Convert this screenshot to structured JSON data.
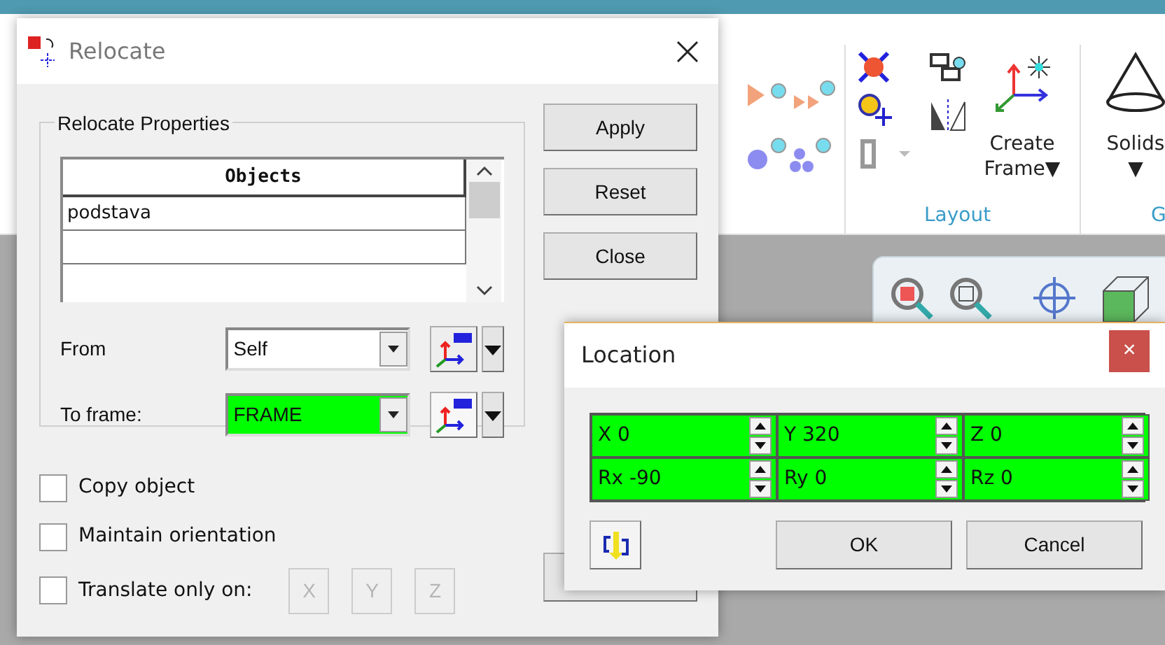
{
  "ribbon": {
    "buttons": [
      {
        "label": "Create Frame",
        "caret": "▼"
      },
      {
        "label": "Solids",
        "caret": "▼"
      }
    ],
    "groups": [
      "Layout",
      "G"
    ]
  },
  "relocate": {
    "title": "Relocate",
    "group": "Relocate Properties",
    "table": {
      "columns": [
        "Objects"
      ],
      "rows": [
        "podstava",
        ""
      ]
    },
    "buttons": [
      "Apply",
      "Reset",
      "Close"
    ],
    "frames": [
      {
        "label": "From",
        "value": "Self",
        "highlighted": false
      },
      {
        "label": "To frame:",
        "value": "FRAME",
        "highlighted": true
      }
    ],
    "checkboxes": [
      {
        "label": "Copy object",
        "checked": false
      },
      {
        "label": "Maintain orientation",
        "checked": false
      },
      {
        "label": "Translate only on:",
        "checked": false
      }
    ],
    "axis_buttons": [
      {
        "label": "X",
        "disabled": true
      },
      {
        "label": "Y",
        "disabled": true
      },
      {
        "label": "Z",
        "disabled": true
      }
    ]
  },
  "location": {
    "title": "Location",
    "close": "×",
    "fields": [
      {
        "label": "X",
        "value": "0"
      },
      {
        "label": "Y",
        "value": "320"
      },
      {
        "label": "Z",
        "value": "0"
      },
      {
        "label": "Rx",
        "value": "-90"
      },
      {
        "label": "Ry",
        "value": "0"
      },
      {
        "label": "Rz",
        "value": "0"
      }
    ],
    "buttons": [
      "OK",
      "Cancel"
    ]
  }
}
